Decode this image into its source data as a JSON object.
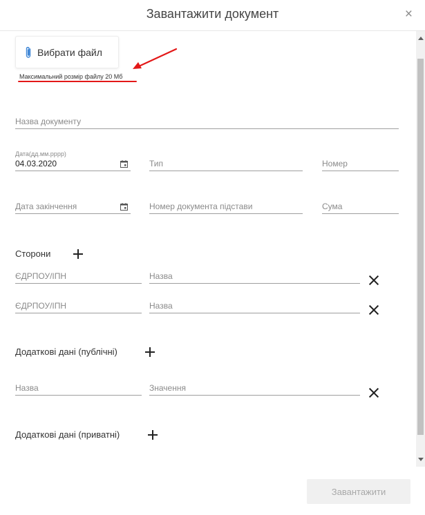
{
  "dialog": {
    "title": "Завантажити документ",
    "close_icon": "×"
  },
  "upload": {
    "button_label": "Вибрати файл",
    "max_size_note": "Максимальний розмір файлу 20 Мб",
    "icon": "paperclip-icon",
    "annotation_color": "#e31818"
  },
  "fields": {
    "document_name": {
      "placeholder": "Назва документу"
    },
    "date": {
      "label": "Дата(дд.мм.рррр)",
      "value": "04.03.2020"
    },
    "type": {
      "placeholder": "Тип"
    },
    "number": {
      "placeholder": "Номер"
    },
    "end_date": {
      "placeholder": "Дата закінчення"
    },
    "basis_number": {
      "placeholder": "Номер документа підстави"
    },
    "sum": {
      "placeholder": "Сума"
    }
  },
  "parties": {
    "label": "Сторони",
    "rows": [
      {
        "code_placeholder": "ЄДРПОУ/ІПН",
        "name_placeholder": "Назва"
      },
      {
        "code_placeholder": "ЄДРПОУ/ІПН",
        "name_placeholder": "Назва"
      }
    ]
  },
  "public_data": {
    "label": "Додаткові дані (публічні)",
    "rows": [
      {
        "name_placeholder": "Назва",
        "value_placeholder": "Значення"
      }
    ]
  },
  "private_data": {
    "label": "Додаткові дані (приватні)"
  },
  "footer": {
    "submit_label": "Завантажити"
  }
}
